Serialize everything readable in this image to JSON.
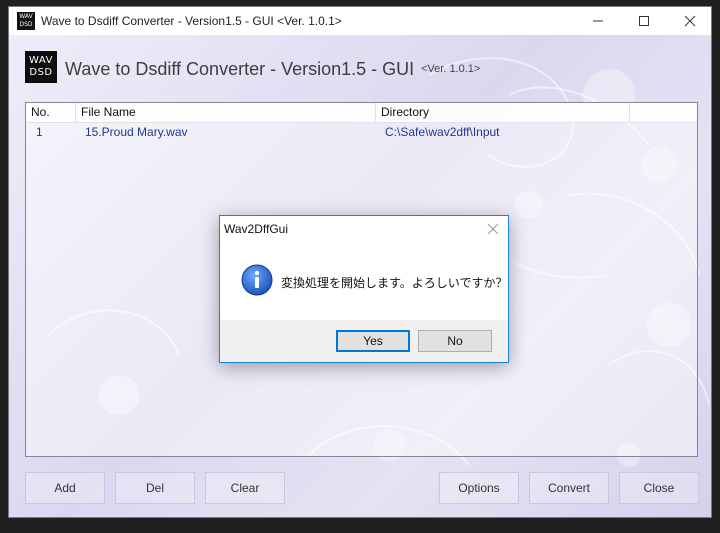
{
  "window": {
    "title": "Wave to Dsdiff Converter - Version1.5 - GUI <Ver. 1.0.1>",
    "icon_text_top": "WAV",
    "icon_text_bottom": "DSD"
  },
  "header": {
    "logo_top": "WAV",
    "logo_bottom": "DSD",
    "title": "Wave to Dsdiff Converter - Version1.5 - GUI",
    "version": "<Ver. 1.0.1>"
  },
  "list": {
    "columns": [
      "No.",
      "File Name",
      "Directory"
    ],
    "rows": [
      {
        "no": "1",
        "file_name": "15.Proud Mary.wav",
        "directory": "C:\\Safe\\wav2dff\\Input"
      }
    ]
  },
  "buttons": {
    "add": "Add",
    "del": "Del",
    "clear": "Clear",
    "options": "Options",
    "convert": "Convert",
    "close": "Close"
  },
  "dialog": {
    "title": "Wav2DffGui",
    "message": "変換処理を開始します。よろしいですか？",
    "yes": "Yes",
    "no": "No",
    "icon": "information-icon"
  },
  "colors": {
    "accent": "#0078d7",
    "dialog_border": "#1883d7",
    "directory_text": "#1f3a8a"
  }
}
